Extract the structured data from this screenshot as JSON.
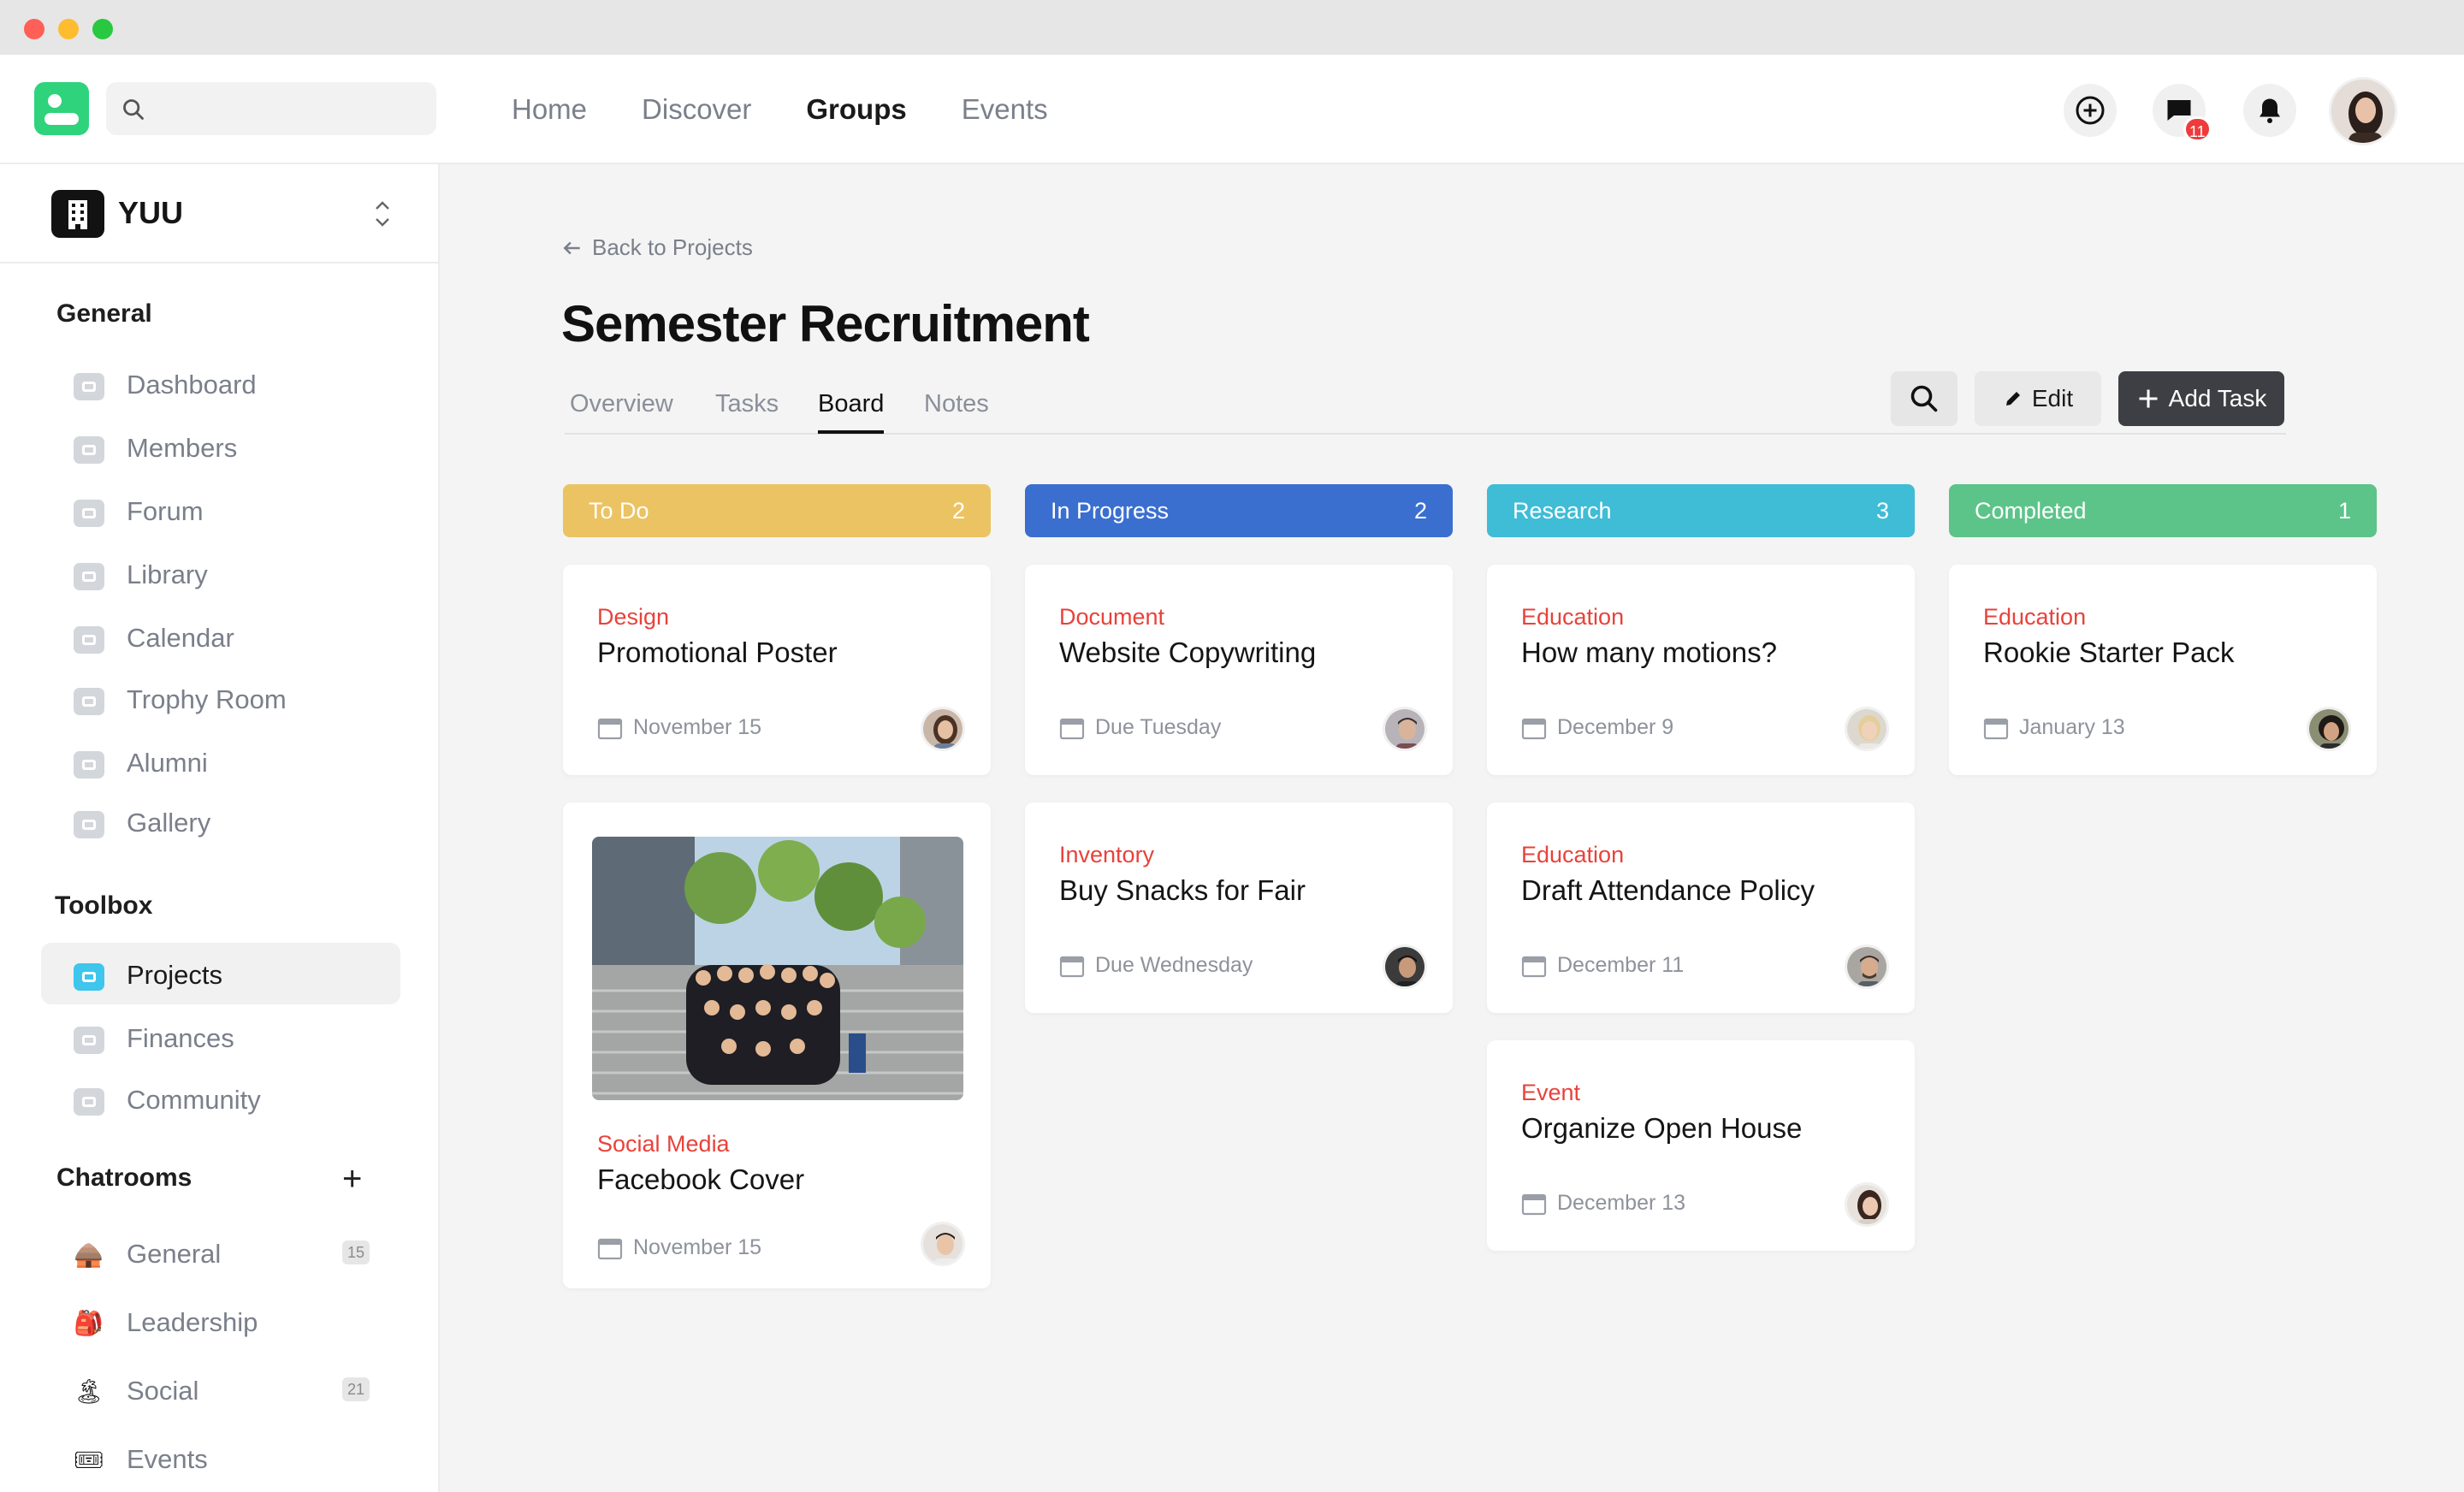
{
  "nav": {
    "links": [
      "Home",
      "Discover",
      "Groups",
      "Events"
    ],
    "active": "Groups",
    "search_placeholder": "",
    "messages_badge": "11"
  },
  "org": {
    "name": "YUU"
  },
  "sidebar": {
    "general_title": "General",
    "general": [
      "Dashboard",
      "Members",
      "Forum",
      "Library",
      "Calendar",
      "Trophy Room",
      "Alumni",
      "Gallery"
    ],
    "toolbox_title": "Toolbox",
    "toolbox": [
      "Projects",
      "Finances",
      "Community"
    ],
    "active": "Projects",
    "chatrooms_title": "Chatrooms",
    "chatrooms": [
      {
        "name": "General",
        "count": "15"
      },
      {
        "name": "Leadership",
        "count": ""
      },
      {
        "name": "Social",
        "count": "21"
      },
      {
        "name": "Events",
        "count": ""
      }
    ]
  },
  "page": {
    "back_label": "Back to Projects",
    "title": "Semester Recruitment",
    "tabs": [
      "Overview",
      "Tasks",
      "Board",
      "Notes"
    ],
    "active_tab": "Board",
    "edit_label": "Edit",
    "add_label": "Add Task"
  },
  "columns": [
    {
      "name": "To Do",
      "count": "2",
      "color": "#ebc362",
      "cards": [
        {
          "category": "Design",
          "title": "Promotional Poster",
          "date": "November 15"
        },
        {
          "category": "Social Media",
          "title": "Facebook Cover",
          "date": "November 15"
        }
      ]
    },
    {
      "name": "In Progress",
      "count": "2",
      "color": "#3a6fd0",
      "cards": [
        {
          "category": "Document",
          "title": "Website Copywriting",
          "date": "Due Tuesday"
        },
        {
          "category": "Inventory",
          "title": "Buy Snacks for Fair",
          "date": "Due Wednesday"
        }
      ]
    },
    {
      "name": "Research",
      "count": "3",
      "color": "#3fbcd6",
      "cards": [
        {
          "category": "Education",
          "title": "How many motions?",
          "date": "December 9"
        },
        {
          "category": "Education",
          "title": "Draft Attendance Policy",
          "date": "December 11"
        },
        {
          "category": "Event",
          "title": "Organize Open House",
          "date": "December 13"
        }
      ]
    },
    {
      "name": "Completed",
      "count": "1",
      "color": "#5cc489",
      "cards": [
        {
          "category": "Education",
          "title": "Rookie Starter Pack",
          "date": "January 13"
        }
      ]
    }
  ]
}
